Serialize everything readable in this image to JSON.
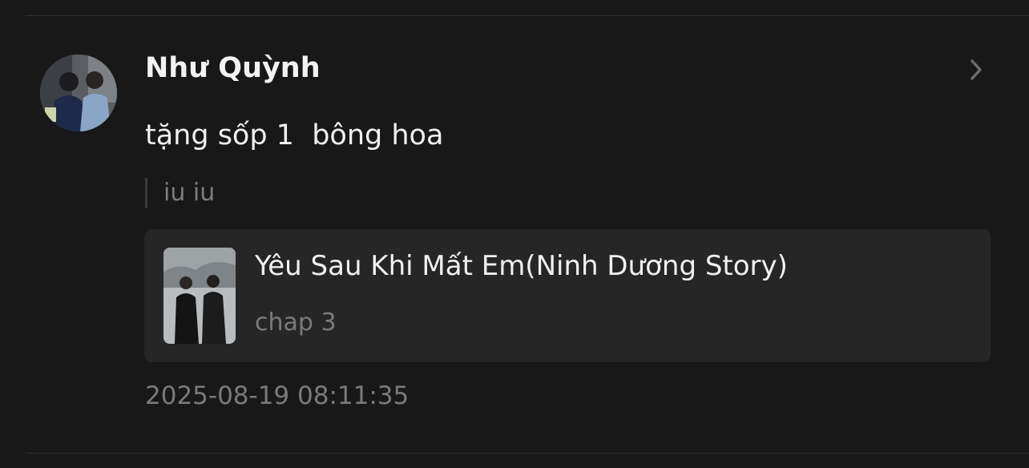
{
  "comment": {
    "username": "Như Quỳnh",
    "message": "tặng sốp 1  bông hoa",
    "quote": "iu iu",
    "timestamp": "2025-08-19 08:11:35"
  },
  "story_card": {
    "title": "Yêu Sau Khi Mất Em(Ninh Dương Story)",
    "chapter": "chap 3"
  },
  "icons": {
    "chevron": "chevron-right-icon"
  },
  "colors": {
    "background": "#181818",
    "card_background": "#262626",
    "primary_text": "#f2f2f2",
    "secondary_text": "#7a7a7a"
  }
}
